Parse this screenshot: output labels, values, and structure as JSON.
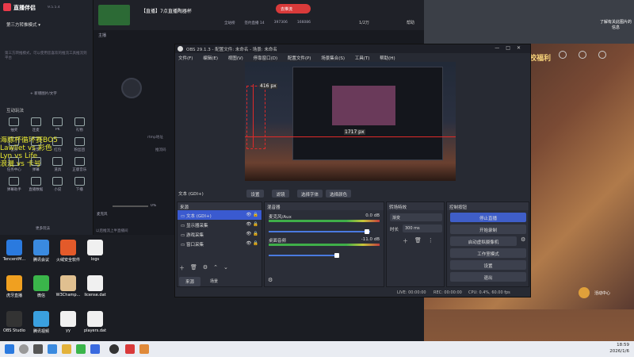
{
  "live_app": {
    "title": "直播伴侣",
    "version": "9.5.5.4",
    "mode_label": "第三方转推模式 ▾",
    "tab_title": "【直播】7点直播陶器杯",
    "stats": [
      "全站榜",
      "签约直播 14",
      "397306",
      "166086"
    ],
    "promo_text": "第三方转推模式，可以使用您喜欢的推流工具推流到平台",
    "add_scene": "+ 新增图片/文字",
    "interact_label": "互动玩法",
    "tools": [
      "抽奖",
      "连麦",
      "PK",
      "礼物",
      "音乐",
      "投票",
      "红包",
      "粉丝团",
      "任务中心",
      "弹幕",
      "道具",
      "正版音乐",
      "弹幕助手",
      "直播数据",
      "小说",
      "下播"
    ],
    "more_label": "更多玩法",
    "overlay_lines": [
      "海豚杯循环赛BO5",
      "Lawliet vs 彩色",
      "Lyn vs Life",
      "浪漫 vs 卡号"
    ],
    "mic_label": "麦克风",
    "volume": "0%",
    "speaker_label": "扬声器",
    "footer_check": "以后推流上半直播间",
    "rtmp_label": "rtmp地址",
    "key_label": "推流码",
    "anchor_label": "主播",
    "status_btn": "去推流",
    "level_label": "1/2万",
    "wish_label": "心愿",
    "help_label": "帮助",
    "right_caption": "了解有关此图片的信息"
  },
  "obs": {
    "title": "OBS 29.1.3 - 配置文件: 未命名 - 场景: 未命名",
    "menu": [
      "文件(F)",
      "编辑(E)",
      "视图(V)",
      "停靠窗口(D)",
      "配置文件(P)",
      "场景集合(S)",
      "工具(T)",
      "帮助(H)"
    ],
    "preview_labels": [
      "416 px",
      "1717 px"
    ],
    "source_toolbar": {
      "source_name": "文本 (GDI+)",
      "settings": "设置",
      "filters": "滤镜",
      "font": "选择字体",
      "color": "选择颜色"
    },
    "sources": {
      "title": "来源",
      "items": [
        "文本 (GDI+)",
        "显示器采集",
        "游戏采集",
        "窗口采集"
      ]
    },
    "mixer": {
      "title": "混音器",
      "channels": [
        {
          "name": "麦克风/Aux",
          "db": "0.0 dB"
        },
        {
          "name": "桌面音频",
          "db": "-11.0 dB"
        }
      ],
      "scale": [
        "-60",
        "-55",
        "-50",
        "-45",
        "-40",
        "-35",
        "-30",
        "-25",
        "-20",
        "-15",
        "-10",
        "-5",
        "0"
      ]
    },
    "transitions": {
      "title": "转场特效",
      "type": "渐变",
      "duration_label": "时长",
      "duration": "300 ms"
    },
    "controls": {
      "title": "控制按钮",
      "buttons": [
        "停止直播",
        "开始录制",
        "启动虚拟摄像机",
        "工作室模式",
        "设置",
        "退出"
      ]
    },
    "tabs": [
      "来源",
      "场景"
    ],
    "status": {
      "live": "LIVE: 00:00:00",
      "rec": "REC: 00:00:00",
      "cpu": "CPU: 0.4%, 60.00 fps"
    }
  },
  "desktop_icons": [
    {
      "label": "TencentM..."
    },
    {
      "label": "腾讯会议"
    },
    {
      "label": "火绒安全软件"
    },
    {
      "label": "logs"
    },
    {
      "label": "虎牙直播"
    },
    {
      "label": "微信"
    },
    {
      "label": "W3Champ..."
    },
    {
      "label": "license.dat"
    },
    {
      "label": "OBS Studio"
    },
    {
      "label": "腾讯视频"
    },
    {
      "label": "yy"
    },
    {
      "label": "players.dat"
    }
  ],
  "game_overlay": {
    "banner": "校福利",
    "activity": "活动中心"
  },
  "taskbar": {
    "time": "18:59",
    "date": "2026/1/6"
  }
}
